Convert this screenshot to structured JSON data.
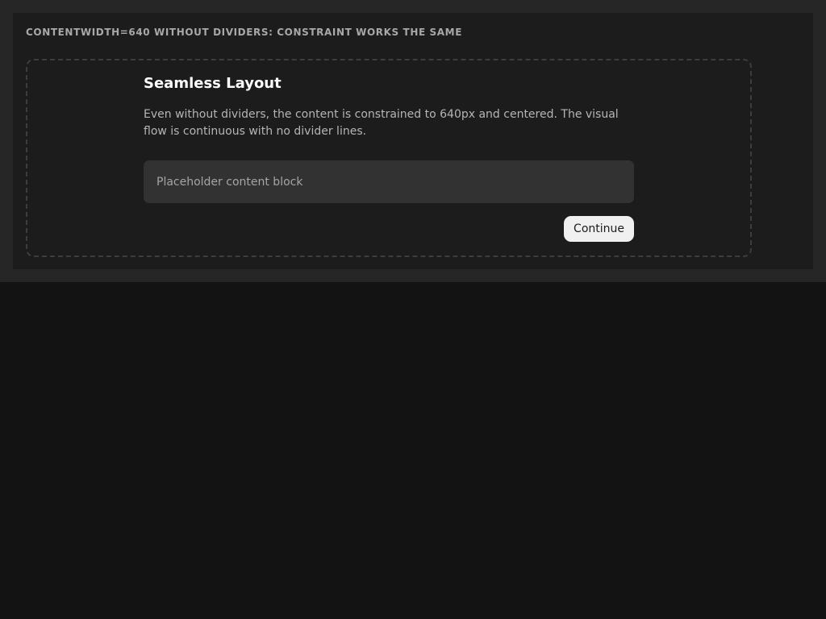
{
  "section": {
    "heading": "CONTENTWIDTH=640 WITHOUT DIVIDERS: CONSTRAINT WORKS THE SAME"
  },
  "card": {
    "title": "Seamless Layout",
    "description": "Even without dividers, the content is constrained to 640px and centered. The visual flow is continuous with no divider lines.",
    "placeholder": "Placeholder content block",
    "continue_label": "Continue"
  },
  "colors": {
    "page_background": "#131313",
    "outer_band": "#262626",
    "panel": "#1c1c1c",
    "placeholder_block": "#323232",
    "button_background": "#f0f0f0"
  }
}
